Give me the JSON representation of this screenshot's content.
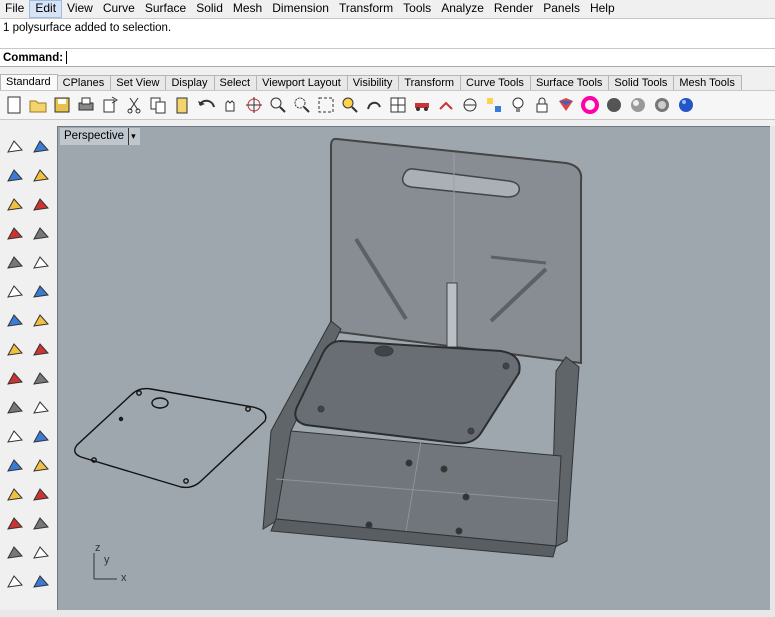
{
  "menu": [
    "File",
    "Edit",
    "View",
    "Curve",
    "Surface",
    "Solid",
    "Mesh",
    "Dimension",
    "Transform",
    "Tools",
    "Analyze",
    "Render",
    "Panels",
    "Help"
  ],
  "menu_active": "Edit",
  "history_line": "1 polysurface added to selection.",
  "command_label": "Command:",
  "tabs": [
    "Standard",
    "CPlanes",
    "Set View",
    "Display",
    "Select",
    "Viewport Layout",
    "Visibility",
    "Transform",
    "Curve Tools",
    "Surface Tools",
    "Solid Tools",
    "Mesh Tools"
  ],
  "toolbar_icons": [
    "new-icon",
    "open-icon",
    "save-icon",
    "print-icon",
    "import-icon",
    "cut-icon",
    "copy-icon",
    "paste-icon",
    "undo-icon",
    "pan-icon",
    "rotate-view-icon",
    "zoom-icon",
    "zoom-window-icon",
    "zoom-extents-icon",
    "zoom-selected-icon",
    "redo-view-icon",
    "viewport-layout-icon",
    "car-icon",
    "select-icon",
    "cplane-icon",
    "grid-snap-icon",
    "lightbulb-icon",
    "lock-icon",
    "material-icon",
    "color-wheel-icon",
    "shaded-icon",
    "rendered-icon",
    "ghosted-icon",
    "sphere-icon"
  ],
  "viewport": {
    "title": "Perspective",
    "menu_arrow": "▾"
  },
  "axes": {
    "z": "z",
    "y": "y",
    "x": "x"
  }
}
